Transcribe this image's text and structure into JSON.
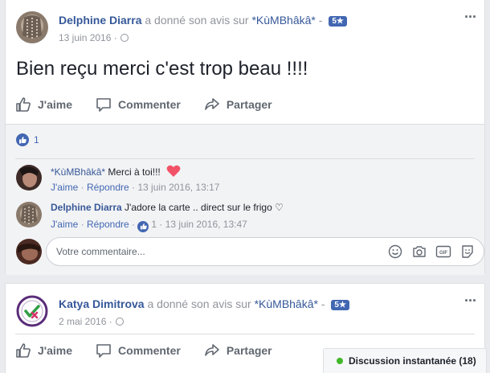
{
  "post1": {
    "author": "Delphine Diarra",
    "verb": " a donné son avis sur ",
    "page": "*KùMBhâkâ*",
    "separator": " - ",
    "rating": "5★",
    "date": "13 juin 2016 ·",
    "text": "Bien reçu merci c'est trop beau !!!!",
    "like_count": "1"
  },
  "actions": {
    "like": "J'aime",
    "comment": "Commenter",
    "share": "Partager"
  },
  "comments": [
    {
      "author": "*KùMBhâkâ*",
      "text": " Merci à toi!!!",
      "like_label": "J'aime",
      "reply_label": "Répondre",
      "date": "13 juin 2016, 13:17"
    },
    {
      "author": "Delphine Diarra",
      "text": " J'adore la carte .. direct sur le frigo ♡",
      "like_label": "J'aime",
      "reply_label": "Répondre",
      "reaction_count": "1",
      "date": "13 juin 2016, 13:47"
    }
  ],
  "comment_input": {
    "placeholder": "Votre commentaire..."
  },
  "post2": {
    "author": "Katya Dimitrova",
    "verb": " a donné son avis sur ",
    "page": "*KùMBhâkâ*",
    "separator": " - ",
    "rating": "5★",
    "date": "2 mai 2016 ·"
  },
  "chat": {
    "label": "Discussion instantanée (18)"
  },
  "colors": {
    "brand": "#4267b2",
    "link": "#385898",
    "online": "#42b72a",
    "heart": "#f25268"
  }
}
